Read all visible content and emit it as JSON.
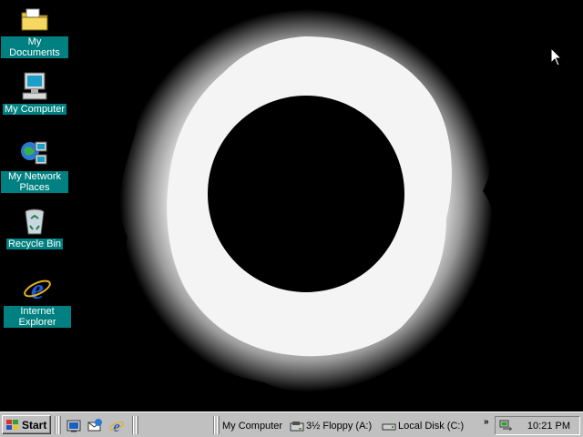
{
  "desktop": {
    "icons": [
      {
        "label": "My Documents",
        "icon": "folder-icon"
      },
      {
        "label": "My Computer",
        "icon": "computer-icon"
      },
      {
        "label": "My Network Places",
        "icon": "network-icon"
      },
      {
        "label": "Recycle Bin",
        "icon": "recycle-bin-icon"
      },
      {
        "label": "Internet Explorer",
        "icon": "internet-explorer-icon"
      }
    ],
    "label_bg": "#008080",
    "wallpaper": "solar eclipse"
  },
  "taskbar": {
    "start_label": "Start",
    "quick_launch": [
      "show-desktop-icon",
      "outlook-express-icon",
      "internet-explorer-icon"
    ],
    "toolbar_items": [
      {
        "label": "My Computer",
        "icon": "computer-icon"
      },
      {
        "label": "3½ Floppy (A:)",
        "icon": "floppy-icon"
      },
      {
        "label": "Local Disk (C:)",
        "icon": "hard-disk-icon"
      }
    ],
    "chevron": "»",
    "clock": "10:21 PM",
    "background": "#c0c0c0"
  }
}
